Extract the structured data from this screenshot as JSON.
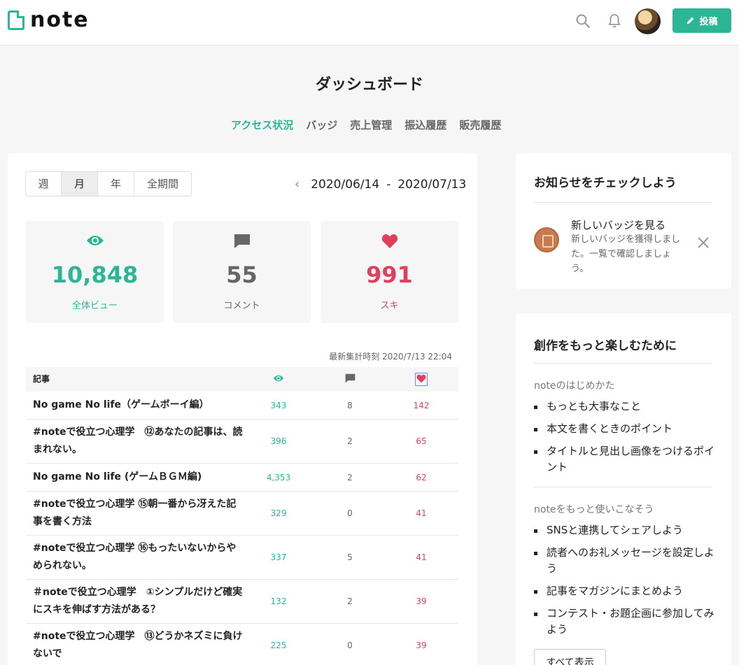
{
  "header": {
    "logo_text": "note",
    "post_label": "投稿"
  },
  "page": {
    "title": "ダッシュボード",
    "tabs": [
      {
        "label": "アクセス状況",
        "active": true
      },
      {
        "label": "バッジ"
      },
      {
        "label": "売上管理"
      },
      {
        "label": "振込履歴"
      },
      {
        "label": "販売履歴"
      }
    ]
  },
  "dashboard": {
    "periods": [
      {
        "label": "週"
      },
      {
        "label": "月",
        "active": true
      },
      {
        "label": "年"
      },
      {
        "label": "全期間"
      }
    ],
    "date_start": "2020/06/14",
    "date_sep": "-",
    "date_end": "2020/07/13",
    "stats": {
      "views": {
        "value": "10,848",
        "label": "全体ビュー",
        "color": "#2cb696"
      },
      "comments": {
        "value": "55",
        "label": "コメント",
        "color": "#666666"
      },
      "likes": {
        "value": "991",
        "label": "スキ",
        "color": "#e0405e"
      }
    },
    "updated": "最新集計時刻 2020/7/13 22:04",
    "table": {
      "header_title": "記事",
      "rows": [
        {
          "title": "No game No life（ゲームボーイ編）",
          "views": "343",
          "comments": "8",
          "likes": "142"
        },
        {
          "title": "#noteで役立つ心理学　⑫あなたの記事は、読まれない。",
          "views": "396",
          "comments": "2",
          "likes": "65"
        },
        {
          "title": "No game No life (ゲームＢＧＭ編)",
          "views": "4,353",
          "comments": "2",
          "likes": "62"
        },
        {
          "title": "#noteで役立つ心理学 ⑮朝一番から冴えた記事を書く方法",
          "views": "329",
          "comments": "0",
          "likes": "41"
        },
        {
          "title": "#noteで役立つ心理学 ⑯もったいないからやめられない。",
          "views": "337",
          "comments": "5",
          "likes": "41"
        },
        {
          "title": "＃noteで役立つ心理学　①シンプルだけど確実にスキを伸ばす方法がある？",
          "views": "132",
          "comments": "2",
          "likes": "39"
        },
        {
          "title": "#noteで役立つ心理学　⑬どうかネズミに負けないで",
          "views": "225",
          "comments": "0",
          "likes": "39"
        }
      ]
    }
  },
  "notice": {
    "heading": "お知らせをチェックしよう",
    "item_title": "新しいバッジを見る",
    "item_body": "新しいバッジを獲得しました。一覧で確認しましょう。"
  },
  "tips": {
    "heading": "創作をもっと楽しむために",
    "section1_label": "noteのはじめかた",
    "section1_items": [
      "もっとも大事なこと",
      "本文を書くときのポイント",
      "タイトルと見出し画像をつけるポイント"
    ],
    "section2_label": "noteをもっと使いこなそう",
    "section2_items": [
      "SNSと連携してシェアしよう",
      "読者へのお礼メッセージを設定しよう",
      "記事をマガジンにまとめよう",
      "コンテスト・お題企画に参加してみよう"
    ],
    "show_all": "すべて表示"
  }
}
